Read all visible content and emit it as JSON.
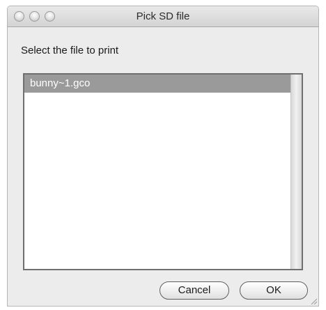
{
  "window": {
    "title": "Pick SD file"
  },
  "dialog": {
    "prompt": "Select the file to print",
    "files": [
      "bunny~1.gco"
    ],
    "selected_file": "bunny~1.gco"
  },
  "buttons": {
    "cancel_label": "Cancel",
    "ok_label": "OK"
  },
  "colors": {
    "selection": "#9a9a9a",
    "window_bg": "#ececec"
  }
}
